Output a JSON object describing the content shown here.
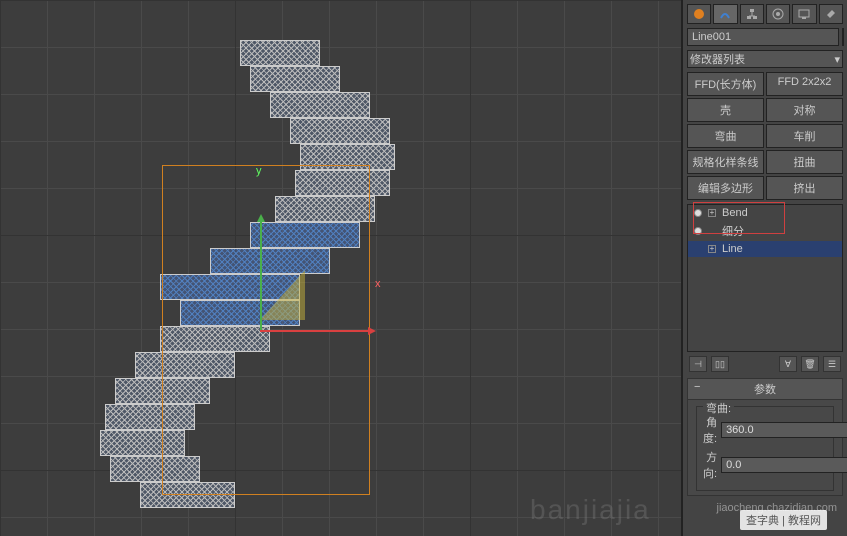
{
  "objectName": "Line001",
  "modifierListLabel": "修改器列表",
  "modButtons": [
    "FFD(长方体)",
    "FFD 2x2x2",
    "壳",
    "对称",
    "弯曲",
    "车削",
    "规格化样条线",
    "扭曲",
    "编辑多边形",
    "挤出"
  ],
  "stack": {
    "items": [
      "Bend",
      "细分",
      "Line"
    ]
  },
  "axisLabels": {
    "x": "x",
    "y": "y"
  },
  "rollout": {
    "title": "参数",
    "groupLabel": "弯曲:",
    "angleLabel": "角度:",
    "angleValue": "360.0",
    "dirLabel": "方向:",
    "dirValue": "0.0"
  },
  "watermark1": "查字典 | 教程网",
  "watermark2": "banjiajia",
  "watermark3": "jiaocheng.chazidian.com"
}
